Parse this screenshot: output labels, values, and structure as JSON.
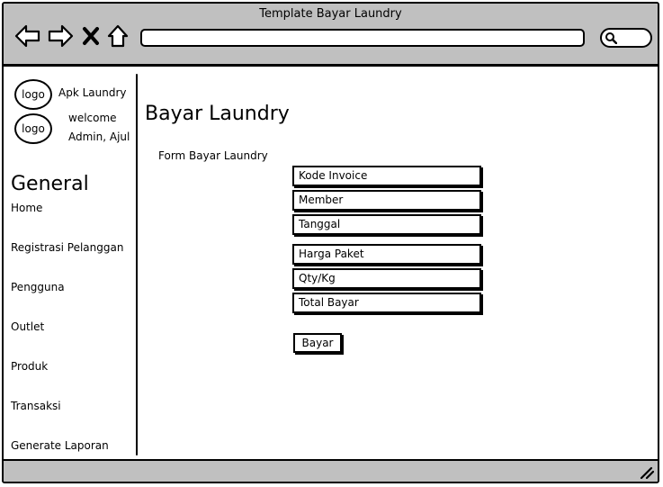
{
  "window": {
    "title": "Template Bayar Laundry"
  },
  "toolbar": {
    "icons": [
      "back-arrow-icon",
      "forward-arrow-icon",
      "close-x-icon",
      "home-icon",
      "search-icon"
    ],
    "url_value": ""
  },
  "sidebar": {
    "logo_label_1": "logo",
    "logo_label_2": "logo",
    "app_name": "Apk Laundry",
    "welcome_line1": "welcome",
    "welcome_line2": "Admin, Ajul",
    "section_title": "General",
    "items": [
      {
        "label": "Home"
      },
      {
        "label": "Registrasi Pelanggan"
      },
      {
        "label": "Pengguna"
      },
      {
        "label": "Outlet"
      },
      {
        "label": "Produk"
      },
      {
        "label": "Transaksi"
      },
      {
        "label": "Generate Laporan"
      }
    ]
  },
  "main": {
    "title": "Bayar Laundry",
    "form_label": "Form Bayar Laundry",
    "fields": [
      {
        "label": "Kode Invoice"
      },
      {
        "label": "Member"
      },
      {
        "label": "Tanggal"
      },
      {
        "label": "Harga Paket"
      },
      {
        "label": "Qty/Kg"
      },
      {
        "label": "Total Bayar"
      }
    ],
    "submit_label": "Bayar"
  }
}
